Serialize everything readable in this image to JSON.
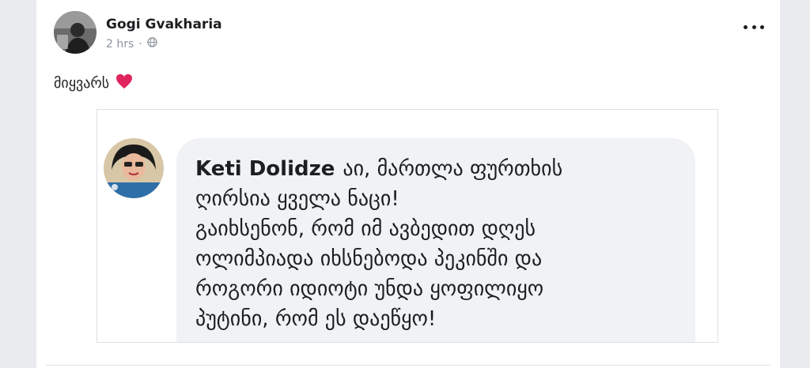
{
  "post": {
    "author": "Gogi Gvakharia",
    "time": "2 hrs",
    "separator": "·",
    "audience_icon": "globe-icon",
    "text": "მიყვარს",
    "emoji": "red-heart-icon",
    "more_icon": "more-options-icon"
  },
  "shared_comment": {
    "author": "Keti Dolidze",
    "text": "აი, მართლა ფურთხის\nღირსია ყველა ნაცი!\nგაიხსენონ, რომ იმ ავბედით დღეს\nოლიმპიადა იხსნებოდა პეკინში და\nროგორი იდიოტი უნდა ყოფილიყო\nპუტინი, რომ ეს დაეწყო!"
  },
  "colors": {
    "page_bg": "#e9ebee",
    "card_bg": "#ffffff",
    "bubble_bg": "#f0f2f5",
    "meta_text": "#8d949e",
    "heart": "#e0245e"
  }
}
